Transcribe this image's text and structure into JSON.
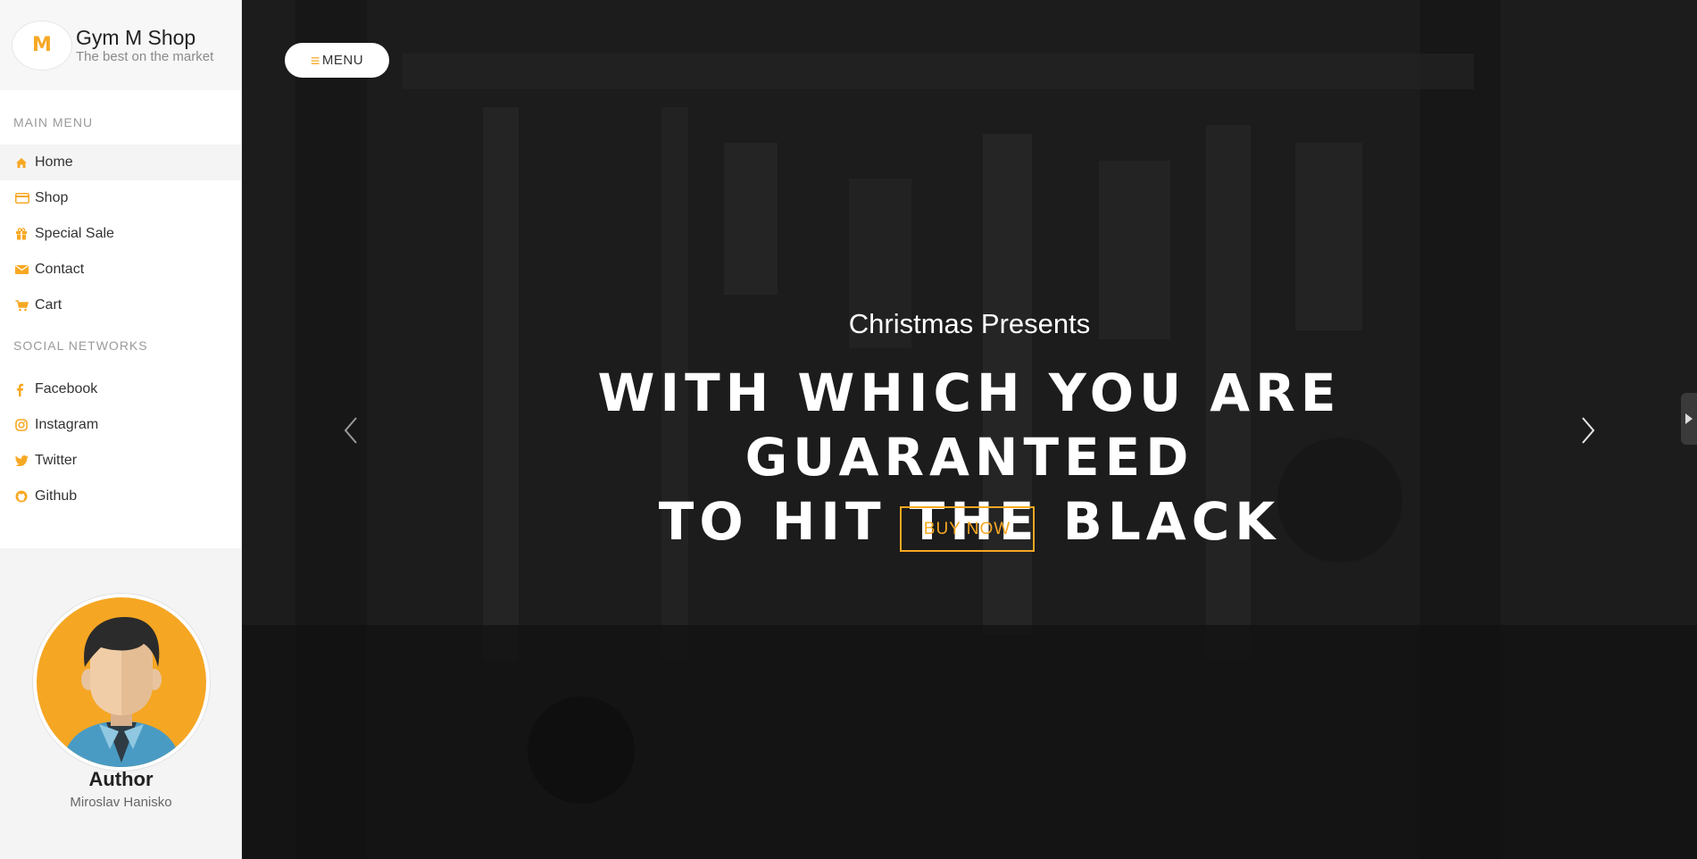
{
  "brand": {
    "logo_letter": "M",
    "title": "Gym M Shop",
    "subtitle": "The best on the market"
  },
  "sidebar": {
    "main_menu_title": "MAIN MENU",
    "main_menu": [
      {
        "label": "Home",
        "icon": "home-icon"
      },
      {
        "label": "Shop",
        "icon": "credit-card-icon"
      },
      {
        "label": "Special Sale",
        "icon": "gift-icon"
      },
      {
        "label": "Contact",
        "icon": "envelope-icon"
      },
      {
        "label": "Cart",
        "icon": "cart-icon"
      }
    ],
    "social_title": "SOCIAL NETWORKS",
    "social": [
      {
        "label": "Facebook",
        "icon": "facebook-icon"
      },
      {
        "label": "Instagram",
        "icon": "instagram-icon"
      },
      {
        "label": "Twitter",
        "icon": "twitter-icon"
      },
      {
        "label": "Github",
        "icon": "github-icon"
      }
    ]
  },
  "author": {
    "title": "Author",
    "name": "Miroslav Hanisko"
  },
  "hero": {
    "menu_button": "MENU",
    "subtitle": "Christmas Presents",
    "headline_line1": "WITH WHICH YOU ARE GUARANTEED",
    "headline_line2": "TO HIT THE BLACK",
    "cta": "BUY NOW"
  },
  "colors": {
    "accent": "#f7a823",
    "hero_bg": "#1d1d1d",
    "sidebar_bg": "#ffffff"
  }
}
